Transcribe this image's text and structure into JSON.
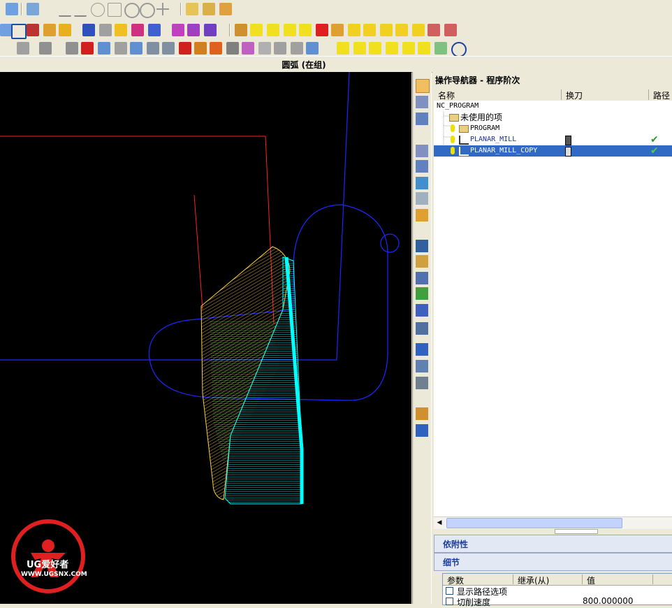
{
  "viewport": {
    "title": "圆弧 (在组)"
  },
  "navigator": {
    "title": "操作导航器 - 程序阶次",
    "columns": {
      "name": "名称",
      "tool_change": "换刀",
      "path": "路径"
    },
    "rows": [
      {
        "label": "NC_PROGRAM",
        "status": ""
      },
      {
        "label": "未使用的项",
        "status": ""
      },
      {
        "label": "PROGRAM",
        "status": ""
      },
      {
        "label": "PLANAR_MILL",
        "status": "✔"
      },
      {
        "label": "PLANAR_MILL_COPY",
        "status": "✔"
      }
    ]
  },
  "panels": {
    "dependencies": "依附性",
    "details": "细节"
  },
  "details_table": {
    "columns": {
      "param": "参数",
      "inherit": "继承(从)",
      "value": "值"
    },
    "rows": [
      {
        "param": "显示路径选项",
        "inherit": "",
        "value": ""
      },
      {
        "param": "切削速度",
        "inherit": "",
        "value": "800.000000"
      }
    ]
  },
  "watermark": {
    "brand": "UG爱好者",
    "url": "WWW.UGSNX.COM"
  },
  "colors": {
    "selection": "#316ac5",
    "toolpath_cyan": "#00ffff",
    "toolpath_yellow": "#ffcc44",
    "geometry_blue": "#1c28ff",
    "geometry_red": "#ff2020"
  }
}
